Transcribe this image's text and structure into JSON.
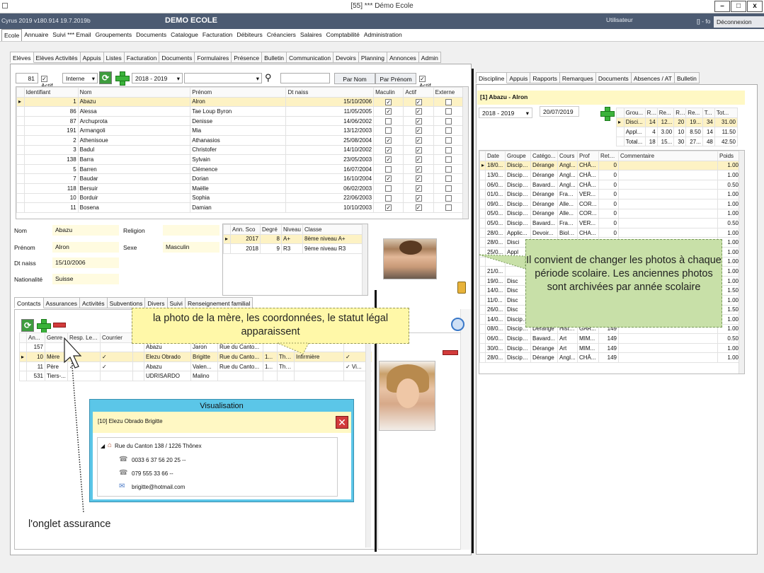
{
  "window": {
    "title": "[55] *** Démo Ecole",
    "min": "–",
    "max": "□",
    "close": "x"
  },
  "appbar": {
    "version": "Cyrus 2019 v180.914 19.7.2019b",
    "school": "DEMO ECOLE",
    "user_label": "Utilisateur",
    "user_short": "[] - fo",
    "logout": "Déconnexion"
  },
  "menu": [
    "Ecole",
    "Annuaire",
    "Suivi *** Email",
    "Groupements",
    "Documents",
    "Catalogue",
    "Facturation",
    "Débiteurs",
    "Créanciers",
    "Salaires",
    "Comptabilité",
    "Administration"
  ],
  "subtabs": [
    "Elèves",
    "Elèves Activités",
    "Appuis",
    "Listes",
    "Facturation",
    "Documents",
    "Formulaires",
    "Présence",
    "Bulletin",
    "Communication",
    "Devoirs",
    "Planning",
    "Annonces",
    "Admin"
  ],
  "filter": {
    "count": "81",
    "actif_label": "Actif",
    "status": "Interne",
    "year": "2018 - 2019",
    "btn_nom": "Par Nom",
    "btn_prenom": "Par Prénom",
    "actif2": "Actif"
  },
  "students": {
    "headers": [
      "Identifiant",
      "Nom",
      "Prénom",
      "Dt naiss",
      "Maculin",
      "Actif",
      "Externe"
    ],
    "rows": [
      [
        "1",
        "Abazu",
        "Alron",
        "15/10/2006",
        true,
        true,
        false
      ],
      [
        "86",
        "Alessa",
        "Tae Loup Byron",
        "11/05/2005",
        true,
        true,
        false
      ],
      [
        "87",
        "Archuprota",
        "Denisse",
        "14/06/2002",
        false,
        true,
        false
      ],
      [
        "191",
        "Armangoli",
        "Mia",
        "13/12/2003",
        false,
        true,
        false
      ],
      [
        "2",
        "Athenisoue",
        "Athanasios",
        "25/08/2004",
        true,
        true,
        false
      ],
      [
        "3",
        "Badul",
        "Christofer",
        "14/10/2002",
        true,
        true,
        false
      ],
      [
        "138",
        "Barra",
        "Sylvain",
        "23/05/2003",
        true,
        true,
        false
      ],
      [
        "5",
        "Barren",
        "Clémence",
        "16/07/2004",
        false,
        true,
        false
      ],
      [
        "7",
        "Baudar",
        "Dorian",
        "16/10/2004",
        true,
        true,
        false
      ],
      [
        "118",
        "Bersuir",
        "Maëlle",
        "06/02/2003",
        false,
        true,
        false
      ],
      [
        "10",
        "Borduir",
        "Sophia",
        "22/06/2003",
        false,
        true,
        false
      ],
      [
        "11",
        "Bosena",
        "Damian",
        "10/10/2003",
        true,
        true,
        false
      ]
    ]
  },
  "detail": {
    "nom_label": "Nom",
    "nom": "Abazu",
    "religion_label": "Religion",
    "prenom_label": "Prénom",
    "prenom": "Alron",
    "sexe_label": "Sexe",
    "sexe": "Masculin",
    "dtnaiss_label": "Dt naiss",
    "dtnaiss": "15/10/2006",
    "nationalite_label": "Nationalité",
    "nationalite": "Suisse"
  },
  "school_years": {
    "headers": [
      "Ann. Sco",
      "Degré",
      "Niveau",
      "Classe"
    ],
    "rows": [
      [
        "2017",
        "8",
        "A+",
        "8ème niveau A+"
      ],
      [
        "2018",
        "9",
        "R3",
        "9ème niveau R3"
      ]
    ]
  },
  "contact_tabs": [
    "Contacts",
    "Assurances",
    "Activités",
    "Subventions",
    "Divers",
    "Suivi",
    "Renseignement familial"
  ],
  "contacts": {
    "headers": [
      "An...",
      "Genre",
      "Resp. Legal",
      "Courrier",
      "",
      "",
      "",
      "",
      "",
      "",
      "",
      ""
    ],
    "rows": [
      [
        "157",
        "",
        "",
        "",
        "",
        "Abazu",
        "Jaron",
        "Rue du Canto...",
        "",
        "",
        "",
        ""
      ],
      [
        "10",
        "Mère",
        "✓",
        "✓",
        "",
        "Elezu Obrado",
        "Brigitte",
        "Rue du Canto...",
        "1...",
        "Thô...",
        "Infirmière",
        "✓"
      ],
      [
        "11",
        "Père",
        "✓",
        "✓",
        "",
        "Abazu",
        "Valen...",
        "Rue du Canto...",
        "1...",
        "Thô...",
        "",
        "✓ Vi..."
      ],
      [
        "531",
        "Tiers-...",
        "",
        "",
        "",
        "UDRISARDO",
        "Malino",
        "",
        "",
        "",
        "",
        ""
      ]
    ]
  },
  "popup": {
    "title": "Visualisation",
    "name": "[10] Elezu Obrado Brigitte",
    "address": "Rue du Canton 138 / 1226 Thônex",
    "phone1": "0033 6 37 56 20 25 --",
    "phone2": "079 555 33 66 --",
    "email": "brigitte@hotmail.com"
  },
  "right_tabs": [
    "Discipline",
    "Appuis",
    "Rapports",
    "Remarques",
    "Documents",
    "Absences / AT",
    "Bulletin"
  ],
  "right_header": "[1] Abazu - Alron",
  "right_year": "2018 - 2019",
  "right_date": "20/07/2019",
  "summary": {
    "headers": [
      "Grou...",
      "R...",
      "Re...",
      "R...",
      "Re...",
      "T...",
      "Tot..."
    ],
    "rows": [
      [
        "Disci...",
        "14",
        "12...",
        "20",
        "19...",
        "34",
        "31.00"
      ],
      [
        "Appl...",
        "4",
        "3.00",
        "10",
        "8.50",
        "14",
        "11.50"
      ],
      [
        "Total...",
        "18",
        "15...",
        "30",
        "27...",
        "48",
        "42.50"
      ]
    ]
  },
  "discipline": {
    "headers": [
      "Date",
      "Groupe",
      "Catégo...",
      "Cours",
      "Prof",
      "Rete...",
      "Commentaire",
      "Poids"
    ],
    "rows": [
      [
        "18/0...",
        "Discipli...",
        "Dérange",
        "Angl...",
        "CHÂ...",
        "0",
        "",
        "1.00"
      ],
      [
        "13/0...",
        "Discipli...",
        "Dérange",
        "Angl...",
        "CHÂ...",
        "0",
        "",
        "1.00"
      ],
      [
        "06/0...",
        "Discipli...",
        "Bavard...",
        "Angl...",
        "CHÂ...",
        "0",
        "",
        "0.50"
      ],
      [
        "01/0...",
        "Discipli...",
        "Dérange",
        "Fran...",
        "VER...",
        "0",
        "",
        "1.00"
      ],
      [
        "09/0...",
        "Discipli...",
        "Dérange",
        "Alle...",
        "COR...",
        "0",
        "",
        "1.00"
      ],
      [
        "05/0...",
        "Discipli...",
        "Dérange",
        "Alle...",
        "COR...",
        "0",
        "",
        "1.00"
      ],
      [
        "05/0...",
        "Discipli...",
        "Bavard...",
        "Fran...",
        "VER...",
        "0",
        "",
        "0.50"
      ],
      [
        "28/0...",
        "Applic...",
        "Devoir...",
        "Biolo...",
        "CHA...",
        "0",
        "",
        "1.00"
      ],
      [
        "28/0...",
        "Disci",
        "",
        "",
        "",
        "",
        "",
        "1.00"
      ],
      [
        "25/0...",
        "Appl",
        "",
        "",
        "",
        "",
        "",
        "1.00"
      ],
      [
        "",
        "",
        "",
        "",
        "",
        "",
        "",
        "1.00"
      ],
      [
        "21/0...",
        "",
        "",
        "",
        "",
        "",
        "",
        "1.00"
      ],
      [
        "19/0...",
        "Disc",
        "",
        "",
        "",
        "",
        "",
        "1.00"
      ],
      [
        "14/0...",
        "Disc",
        "",
        "",
        "",
        "",
        "",
        "1.50"
      ],
      [
        "11/0...",
        "Disc",
        "",
        "",
        "",
        "",
        "",
        "1.00"
      ],
      [
        "26/0...",
        "Disc",
        "",
        "",
        "",
        "",
        "",
        "1.50"
      ],
      [
        "14/0...",
        "Discipli...",
        "Dérange",
        "Sport",
        "GAR...",
        "149",
        "",
        "1.00"
      ],
      [
        "08/0...",
        "Discipli...",
        "Dérange",
        "Histo...",
        "GAR...",
        "149",
        "",
        "1.00"
      ],
      [
        "06/0...",
        "Discipli...",
        "Bavard...",
        "Art",
        "MIM...",
        "149",
        "",
        "0.50"
      ],
      [
        "30/0...",
        "Discipli...",
        "Dérange",
        "Art",
        "MIM...",
        "149",
        "",
        "1.00"
      ],
      [
        "28/0...",
        "Discipli...",
        "Dérange",
        "Angl...",
        "CHÂ...",
        "149",
        "",
        "1.00"
      ]
    ]
  },
  "callouts": {
    "mother": "la photo de la mère, les coordonnées, le statut légal apparaissent",
    "photos": "Il convient de changer les photos à chaque période scolaire. Les anciennes photos sont archivées par année scolaire",
    "assurance": "l'onglet assurance"
  },
  "colors": {
    "appbar": "#4c5b72",
    "highlight": "#fdf2c4",
    "field": "#fffbe0",
    "callout_yellow": "#fff8a8",
    "callout_green": "#c8e0a8",
    "popup_title": "#5bc6e8"
  }
}
